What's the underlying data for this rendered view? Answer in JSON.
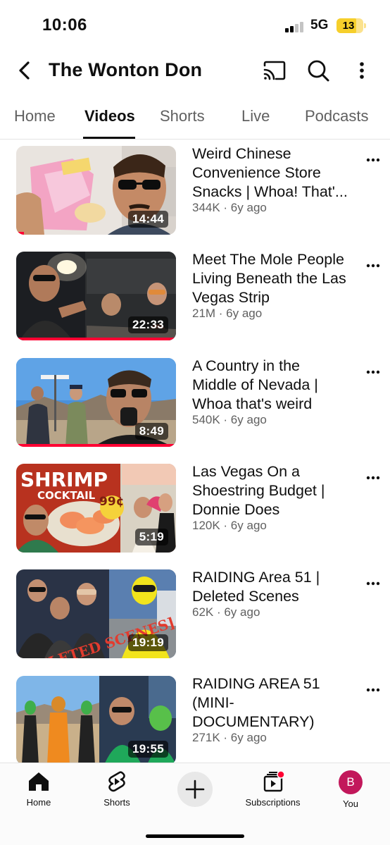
{
  "status_bar": {
    "time": "10:06",
    "network": "5G",
    "battery": "13",
    "battery_color": "#f6cf2b"
  },
  "header": {
    "back_icon": "chevron-left-icon",
    "title": "The Wonton Don",
    "icons": [
      "cast-icon",
      "search-icon",
      "more-vertical-icon"
    ]
  },
  "tabs": [
    {
      "label": "Home",
      "active": false
    },
    {
      "label": "Videos",
      "active": true
    },
    {
      "label": "Shorts",
      "active": false
    },
    {
      "label": "Live",
      "active": false
    },
    {
      "label": "Podcasts",
      "active": false
    }
  ],
  "videos": [
    {
      "title_lines": [
        "Weird Chinese",
        "Convenience Store",
        "Snacks | Whoa! That'..."
      ],
      "meta": "344K · 6y ago",
      "duration": "14:44",
      "watched": 0.05
    },
    {
      "title_lines": [
        "Meet The Mole People",
        "Living Beneath the Las",
        "Vegas Strip"
      ],
      "meta": "21M · 6y ago",
      "duration": "22:33",
      "watched": 1.0
    },
    {
      "title_lines": [
        "A Country in the",
        "Middle of Nevada |",
        "Whoa that's weird"
      ],
      "meta": "540K · 6y ago",
      "duration": "8:49",
      "watched": 1.0
    },
    {
      "title_lines": [
        "Las Vegas On a",
        "Shoestring Budget |",
        "Donnie Does"
      ],
      "meta": "120K · 6y ago",
      "duration": "5:19",
      "watched": 0,
      "thumb_text": {
        "big": "SHRIMP",
        "small": "COCKTAIL",
        "price": "99¢"
      }
    },
    {
      "title_lines": [
        "RAIDING Area 51 |",
        "Deleted Scenes"
      ],
      "meta": "62K · 6y ago",
      "duration": "19:19",
      "watched": 0,
      "thumb_text": {
        "stamp": "[DELETED SCENES]"
      }
    },
    {
      "title_lines": [
        "RAIDING AREA 51",
        "(MINI-",
        "DOCUMENTARY)"
      ],
      "meta": "271K · 6y ago",
      "duration": "19:55",
      "watched": 0
    }
  ],
  "bottom_nav": [
    {
      "label": "Home",
      "icon": "home-icon"
    },
    {
      "label": "Shorts",
      "icon": "shorts-icon"
    },
    {
      "label": "",
      "icon": "plus-icon"
    },
    {
      "label": "Subscriptions",
      "icon": "subscriptions-icon"
    },
    {
      "label": "You",
      "icon": "avatar",
      "initial": "B"
    }
  ],
  "colors": {
    "accent_red": "#ff0033",
    "text_primary": "#0f0f0f",
    "text_secondary": "#606060"
  }
}
